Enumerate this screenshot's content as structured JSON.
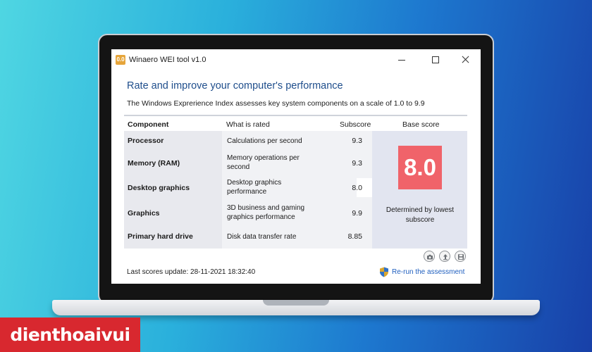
{
  "window": {
    "app_icon_text": "0.0",
    "title": "Winaero WEI tool v1.0"
  },
  "heading": "Rate and improve your computer's performance",
  "subheading": "The Windows Exprerience Index assesses key system components on a scale of 1.0 to 9.9",
  "table": {
    "headers": {
      "component": "Component",
      "what_is_rated": "What is rated",
      "subscore": "Subscore",
      "base_score": "Base score"
    },
    "rows": [
      {
        "component": "Processor",
        "rated": "Calculations per second",
        "subscore": "9.3"
      },
      {
        "component": "Memory (RAM)",
        "rated": "Memory operations per second",
        "subscore": "9.3"
      },
      {
        "component": "Desktop graphics",
        "rated": "Desktop graphics performance",
        "subscore": "8.0"
      },
      {
        "component": "Graphics",
        "rated": "3D business and gaming graphics performance",
        "subscore": "9.9"
      },
      {
        "component": "Primary hard drive",
        "rated": "Disk data transfer rate",
        "subscore": "8.85"
      }
    ],
    "base_score": "8.0",
    "base_note": "Determined by lowest subscore"
  },
  "footer": {
    "last_update": "Last scores update: 28-11-2021 18:32:40",
    "rerun": "Re-run the assessment",
    "tool_icons": [
      "camera-icon",
      "upload-icon",
      "save-icon"
    ]
  },
  "brand": "dienthoaivui",
  "colors": {
    "heading": "#1f4e8c",
    "base_score_bg": "#f0636a",
    "link": "#1f5fbf",
    "brand_bg": "#d8282f"
  }
}
